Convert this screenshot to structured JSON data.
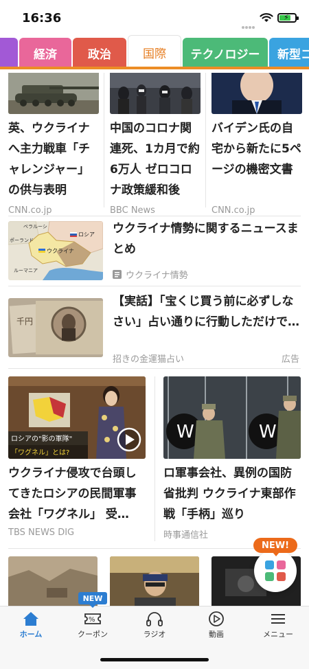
{
  "status_bar": {
    "time": "16:36"
  },
  "tabs": [
    {
      "label": "",
      "color": "#a259d6",
      "active": false
    },
    {
      "label": "経済",
      "color": "#e9679a",
      "active": false
    },
    {
      "label": "政治",
      "color": "#e05a4a",
      "active": false
    },
    {
      "label": "国際",
      "color": "#e67e22",
      "active": true
    },
    {
      "label": "テクノロジー",
      "color": "#4cba78",
      "active": false
    },
    {
      "label": "新型コ",
      "color": "#3aa3e0",
      "active": false
    }
  ],
  "accent_color": "#ec8d26",
  "top_news": [
    {
      "title": "英、ウクライナへ主力戦車「チャレンジャー」の供与表明",
      "source": "CNN.co.jp",
      "image": "tank-image"
    },
    {
      "title": "中国のコロナ関連死、1カ月で約6万人 ゼロコロナ政策緩和後",
      "source": "BBC News",
      "image": "crowd-image"
    },
    {
      "title": "バイデン氏の自宅から新たに5ページの機密文書",
      "source": "CNN.co.jp",
      "image": "biden-image"
    }
  ],
  "feature_article": {
    "title": "ウクライナ情勢に関するニュースまとめ",
    "tag": "ウクライナ情勢",
    "map_labels": {
      "belarus": "ベラルーシ",
      "russia": "ロシア",
      "poland": "ポーランド",
      "ukraine": "ウクライナ",
      "romania": "ルーマニア"
    }
  },
  "ad_article": {
    "title": "【実話】「宝くじ買う前に必ずしなさい」占い通りに行動しただけで…",
    "source": "招きの金運猫占い",
    "ad_label": "広告",
    "image_text": "千円"
  },
  "two_col_news": [
    {
      "title": "ウクライナ侵攻で台頭してきたロシアの民間軍事会社「ワグネル」 受…",
      "source": "TBS NEWS DIG",
      "caption_line1": "ロシアの\"影の軍隊\"",
      "caption_line2": "「ワグネル」とは?",
      "has_video": true
    },
    {
      "title": "ロ軍事会社、異例の国防省批判 ウクライナ東部作戦「手柄」巡り",
      "source": "時事通信社",
      "has_video": false
    }
  ],
  "fab": {
    "badge": "NEW!"
  },
  "bottom_nav": {
    "coupon_badge": "NEW",
    "items": [
      {
        "label": "ホーム",
        "icon": "home-icon",
        "active": true
      },
      {
        "label": "クーポン",
        "icon": "coupon-icon",
        "active": false
      },
      {
        "label": "ラジオ",
        "icon": "headphones-icon",
        "active": false
      },
      {
        "label": "動画",
        "icon": "play-icon",
        "active": false
      },
      {
        "label": "メニュー",
        "icon": "menu-icon",
        "active": false
      }
    ]
  }
}
